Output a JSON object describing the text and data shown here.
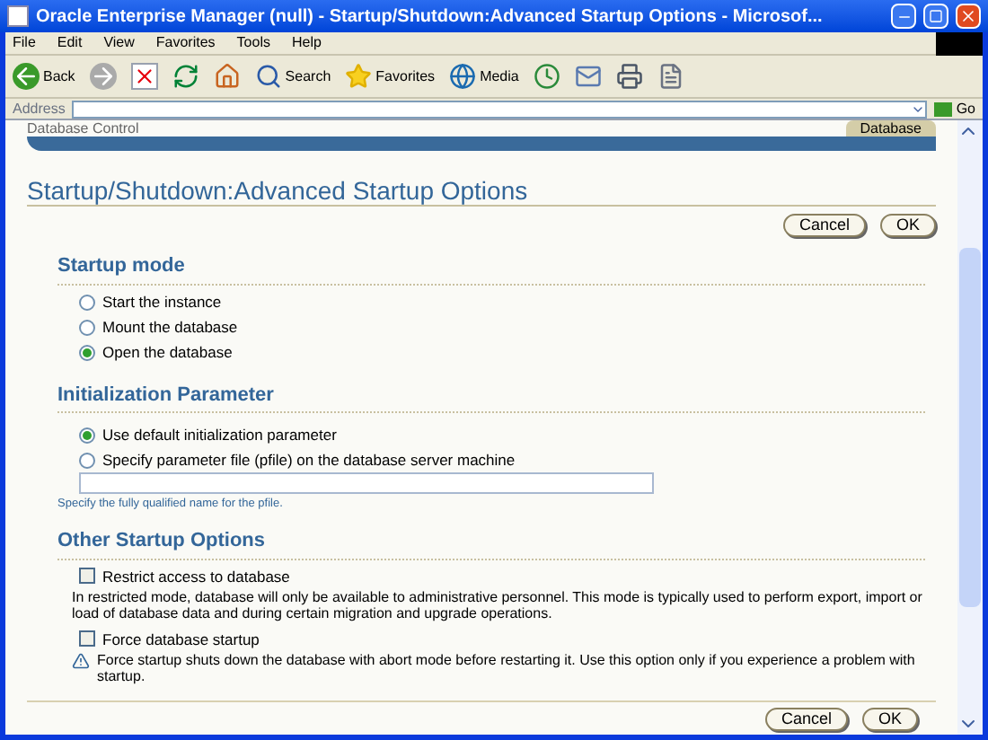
{
  "window": {
    "title": "Oracle Enterprise Manager (null) - Startup/Shutdown:Advanced Startup Options - Microsof..."
  },
  "menu": [
    "File",
    "Edit",
    "View",
    "Favorites",
    "Tools",
    "Help"
  ],
  "toolbar": [
    {
      "kind": "back",
      "label": "Back"
    },
    {
      "kind": "forward"
    },
    {
      "kind": "stop"
    },
    {
      "kind": "refresh"
    },
    {
      "kind": "home"
    },
    {
      "kind": "search",
      "label": "Search"
    },
    {
      "kind": "favorites",
      "label": "Favorites"
    },
    {
      "kind": "media",
      "label": "Media"
    },
    {
      "kind": "history"
    },
    {
      "kind": "mail"
    },
    {
      "kind": "print"
    },
    {
      "kind": "edit"
    }
  ],
  "address": {
    "label": "Address",
    "go": "Go"
  },
  "header": {
    "brand": "Database Control",
    "tab": "Database"
  },
  "page_title": "Startup/Shutdown:Advanced Startup Options",
  "buttons_top": [
    "Cancel",
    "OK"
  ],
  "startup_mode": {
    "heading": "Startup mode",
    "options": [
      {
        "label": "Start the instance",
        "selected": false
      },
      {
        "label": "Mount the database",
        "selected": false
      },
      {
        "label": "Open the database",
        "selected": true
      }
    ]
  },
  "init_param": {
    "heading": "Initialization Parameter",
    "options": [
      {
        "label": "Use default initialization parameter",
        "selected": true
      },
      {
        "label": "Specify parameter file (pfile) on the database server machine",
        "selected": false
      }
    ],
    "hint": "Specify the fully qualified name for the pfile."
  },
  "other": {
    "heading": "Other Startup Options",
    "items": [
      {
        "label": "Restrict access to database",
        "checked": false,
        "note": "In restricted mode, database will only be available to administrative personnel. This mode is typically used to perform export, import or load of database data and during certain migration and upgrade operations.",
        "warning": false
      },
      {
        "label": "Force database startup",
        "checked": false,
        "note": "Force startup shuts down the database with abort mode before restarting it. Use this option only if you experience a problem with startup.",
        "warning": true
      }
    ]
  },
  "buttons_bottom": [
    "Cancel",
    "OK"
  ]
}
